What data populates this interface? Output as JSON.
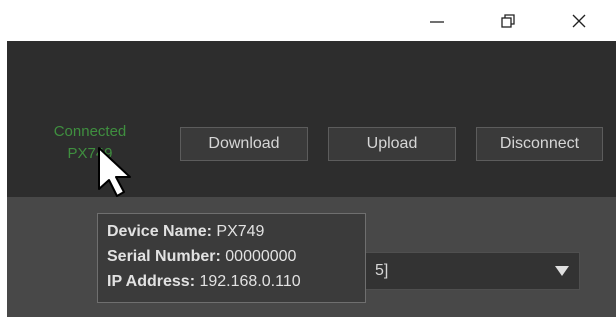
{
  "window": {
    "minimize_icon": "minimize-icon",
    "restore_icon": "restore-icon",
    "close_icon": "close-icon"
  },
  "status": {
    "line1": "Connected",
    "line2": "PX749",
    "color": "#3f8f3f"
  },
  "buttons": {
    "download": "Download",
    "upload": "Upload",
    "disconnect": "Disconnect"
  },
  "select": {
    "value": "5]",
    "arrow_icon": "dropdown-arrow-icon"
  },
  "tooltip": {
    "device_name_label": "Device Name:",
    "device_name": "PX749",
    "serial_label": "Serial Number:",
    "serial": "00000000",
    "ip_label": "IP Address:",
    "ip": "192.168.0.110"
  },
  "colors": {
    "toolbar_bg": "#2d2d2d",
    "panel_bg": "#484848",
    "button_bg": "#3a3a3a",
    "tooltip_bg": "#3b3b3b"
  }
}
